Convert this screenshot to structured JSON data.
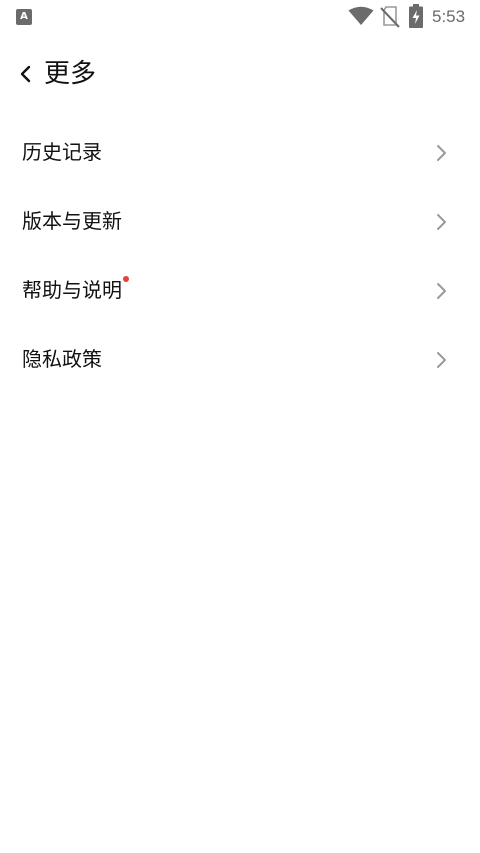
{
  "status_bar": {
    "left_icon_letter": "A",
    "time": "5:53",
    "icons": [
      "notification-a-icon",
      "wifi-icon",
      "no-sim-icon",
      "battery-charging-icon"
    ]
  },
  "header": {
    "title": "更多",
    "back_icon": "chevron-left-icon"
  },
  "menu": {
    "items": [
      {
        "label": "历史记录",
        "has_badge": false
      },
      {
        "label": "版本与更新",
        "has_badge": false
      },
      {
        "label": "帮助与说明",
        "has_badge": true
      },
      {
        "label": "隐私政策",
        "has_badge": false
      }
    ]
  },
  "colors": {
    "text": "#111111",
    "chevron": "#9a9a9a",
    "badge": "#e5403a",
    "status_icons": "#6b6b6b",
    "background": "#ffffff"
  }
}
